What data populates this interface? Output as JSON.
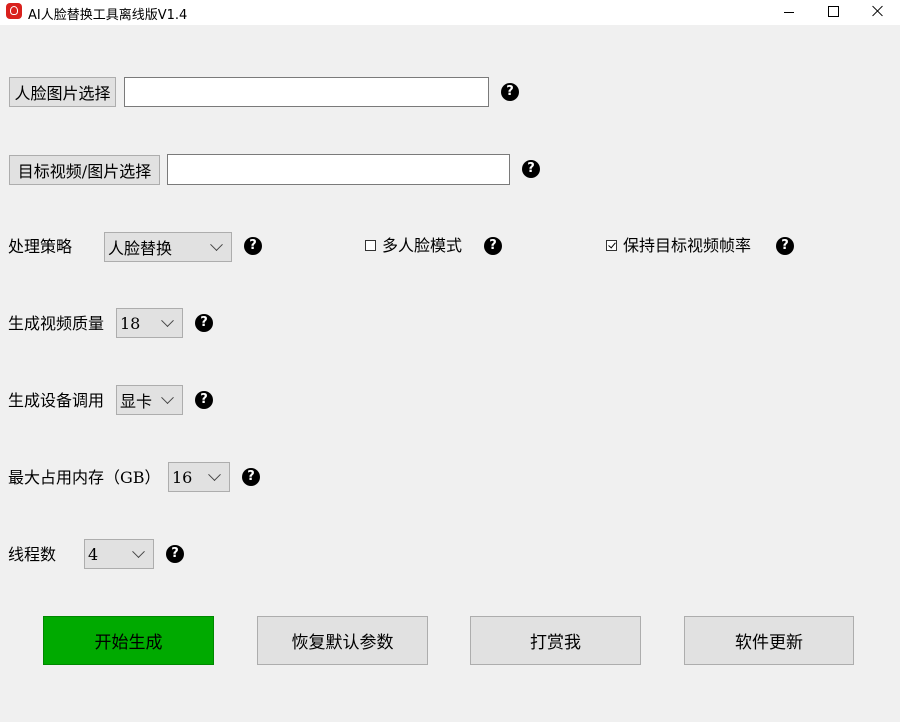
{
  "window": {
    "title": "AI人脸替换工具离线版V1.4"
  },
  "face_image": {
    "button_label": "人脸图片选择",
    "path_value": "",
    "help": "?"
  },
  "target": {
    "button_label": "目标视频/图片选择",
    "path_value": "",
    "help": "?"
  },
  "strategy": {
    "label": "处理策略",
    "selected": "人脸替换",
    "help": "?"
  },
  "multi_face": {
    "label": "多人脸模式",
    "checked": false,
    "help": "?"
  },
  "keep_fps": {
    "label": "保持目标视频帧率",
    "checked": true,
    "help": "?"
  },
  "quality": {
    "label": "生成视频质量",
    "selected": "18",
    "help": "?"
  },
  "device": {
    "label": "生成设备调用",
    "selected": "显卡",
    "help": "?"
  },
  "memory": {
    "label": "最大占用内存（GB）",
    "selected": "16",
    "help": "?"
  },
  "threads": {
    "label": "线程数",
    "selected": "4",
    "help": "?"
  },
  "actions": {
    "start": "开始生成",
    "reset": "恢复默认参数",
    "reward": "打赏我",
    "update": "软件更新"
  },
  "colors": {
    "background": "#f0f0f0",
    "start_button": "#00aa00",
    "app_icon": "#d9211d"
  }
}
